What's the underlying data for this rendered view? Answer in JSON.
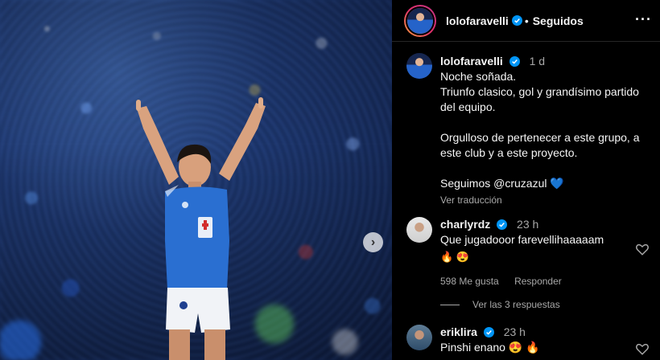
{
  "post": {
    "username": "lolofaravelli",
    "follow_status": "Seguidos",
    "caption_time": "1 d",
    "caption_text": "Noche soñada.\nTriunfo clasico, gol y grandísimo partido del equipo.\n\nOrgulloso de pertenecer a este grupo, a este club y a este proyecto.\n\nSeguimos @cruzazul 💙",
    "translate_label": "Ver traducción"
  },
  "comments": [
    {
      "username": "charlyrdz",
      "time": "23 h",
      "text": "Que jugadooor farevellihaaaaam",
      "emojis": "🔥 😍",
      "likes": "598 Me gusta",
      "reply_label": "Responder",
      "view_replies": "Ver las 3 respuestas"
    },
    {
      "username": "eriklira",
      "time": "23 h",
      "text": "Pinshi enano 😍 🔥"
    }
  ],
  "colors": {
    "verified": "#0095f6",
    "secondary_text": "#a8a8a8",
    "jersey": "#2a6fd1"
  },
  "icons": {
    "verified": "verified-badge-icon",
    "more": "more-options-icon",
    "heart": "heart-icon",
    "next": "chevron-right-icon"
  }
}
